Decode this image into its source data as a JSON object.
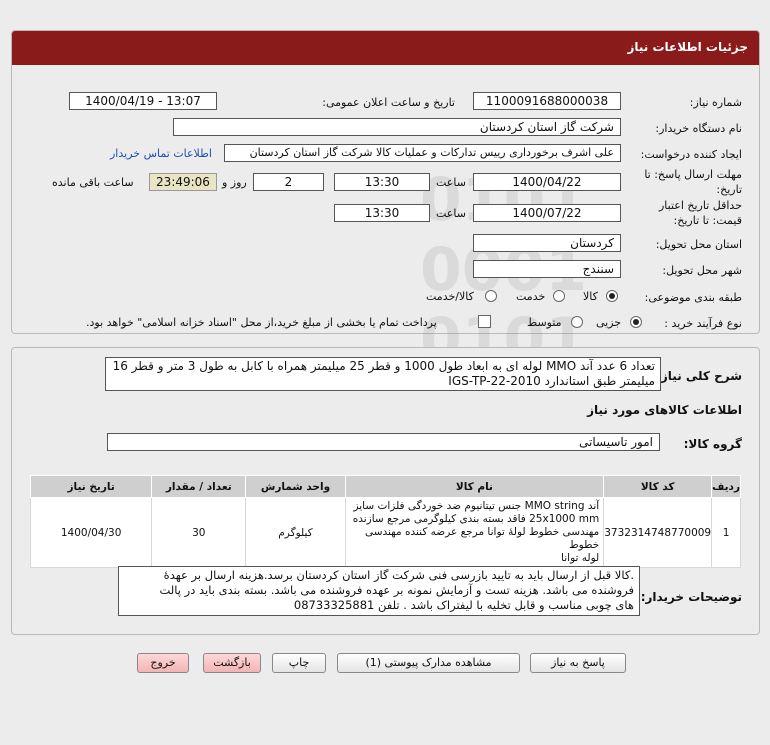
{
  "header": {
    "title": "جزئیات اطلاعات نیاز"
  },
  "info": {
    "need_number_label": "شماره نیاز:",
    "need_number": "1100091688000038",
    "announce_label": "تاریخ و ساعت اعلان عمومی:",
    "announce_value": "1400/04/19 - 13:07",
    "buyer_org_label": "نام دستگاه خریدار:",
    "buyer_org": "شرکت گاز استان کردستان",
    "requester_label": "ایجاد کننده درخواست:",
    "requester": "علی اشرف برخورداری رییس تدارکات و عملیات کالا شرکت گاز استان کردستان",
    "contact_link": "اطلاعات تماس خریدار",
    "deadline_label_1": "مهلت ارسال پاسخ: تا",
    "deadline_label_2": "تاریخ:",
    "deadline_date": "1400/04/22",
    "time_label": "ساعت",
    "deadline_time": "13:30",
    "days_value": "2",
    "days_label": "روز و",
    "remaining_time": "23:49:06",
    "remaining_label": "ساعت باقی مانده",
    "validity_label_1": "حداقل تاریخ اعتبار",
    "validity_label_2": "قیمت: تا تاریخ:",
    "validity_date": "1400/07/22",
    "validity_time_label": "ساعت",
    "validity_time": "13:30",
    "province_label": "استان محل تحویل:",
    "province": "کردستان",
    "city_label": "شهر محل تحویل:",
    "city": "سنندج",
    "category_label": "طبقه بندی موضوعی:",
    "category_options": [
      "کالا",
      "خدمت",
      "کالا/خدمت"
    ],
    "category_selected": "کالا",
    "process_label": "نوع فرآیند خرید :",
    "process_options": [
      "جزیی",
      "متوسط"
    ],
    "process_selected": "جزیی",
    "payment_note": "پرداخت تمام یا بخشی از مبلغ خرید،از محل \"اسناد خزانه اسلامی\" خواهد بود."
  },
  "details": {
    "summary_label": "شرح کلی نیاز:",
    "summary_line1": "تعداد 6 عدد آند MMO لوله ای به ابعاد طول 1000 و قطر 25 میلیمتر همراه با کابل به طول 3 متر و قطر 16",
    "summary_line2": "میلیمتر طبق استاندارد IGS-TP-22-2010",
    "goods_info_title": "اطلاعات کالاهای مورد نیاز",
    "group_label": "گروه کالا:",
    "group_value": "امور تاسیساتی",
    "table": {
      "headers": [
        "ردیف",
        "کد کالا",
        "نام کالا",
        "واحد شمارش",
        "تعداد / مقدار",
        "تاریخ نیاز"
      ],
      "rows": [
        {
          "row": "1",
          "code": "3732314748770009",
          "name_lines": [
            "آند MMO string جنس تیتانیوم ضد خوردگی فلزات سایز",
            "25x1000 mm فاقد بسته بندی کیلوگرمی مرجع سازنده",
            "مهندسی خطوط لولۀ توانا مرجع عرضه کننده مهندسی خطوط",
            "لوله توانا"
          ],
          "unit": "کیلوگرم",
          "quantity": "30",
          "date": "1400/04/30"
        }
      ]
    },
    "buyer_notes_label": "توضیحات خریدار:",
    "buyer_notes_lines": [
      ".کالا قبل از ارسال باید به تایید بازرسی فنی شرکت گاز استان کردستان برسد.هزینه ارسال  بر عهدۀ",
      "فروشنده می باشد. هزینه تست و آزمایش نمونه بر عهده فروشنده می باشد. بسته بندی باید در پالت",
      "های چوبی مناسب و قابل تخلیه با لیفتراک باشد . تلفن 08733325881"
    ]
  },
  "actions": {
    "reply": "پاسخ به نیاز",
    "attachments": "مشاهده مدارک پیوستی (1)",
    "print": "چاپ",
    "back": "بازگشت",
    "exit": "خروج"
  },
  "colors": {
    "header_bg": "#8b1a1a",
    "remaining_bg": "#e9e4c4",
    "link": "#1f4fb0"
  }
}
